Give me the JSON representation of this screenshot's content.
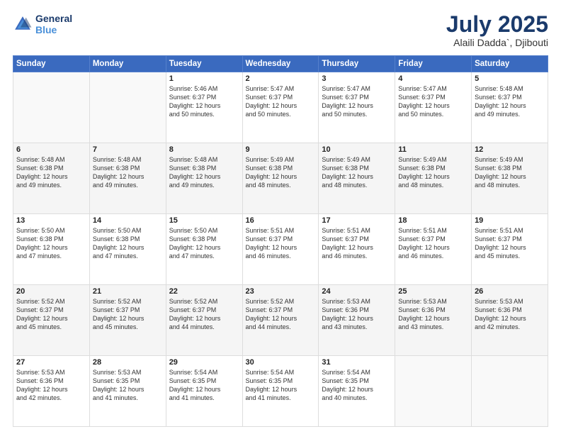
{
  "header": {
    "logo_line1": "General",
    "logo_line2": "Blue",
    "month": "July 2025",
    "location": "Alaili Dadda`, Djibouti"
  },
  "days_of_week": [
    "Sunday",
    "Monday",
    "Tuesday",
    "Wednesday",
    "Thursday",
    "Friday",
    "Saturday"
  ],
  "weeks": [
    [
      {
        "day": "",
        "info": ""
      },
      {
        "day": "",
        "info": ""
      },
      {
        "day": "1",
        "info": "Sunrise: 5:46 AM\nSunset: 6:37 PM\nDaylight: 12 hours\nand 50 minutes."
      },
      {
        "day": "2",
        "info": "Sunrise: 5:47 AM\nSunset: 6:37 PM\nDaylight: 12 hours\nand 50 minutes."
      },
      {
        "day": "3",
        "info": "Sunrise: 5:47 AM\nSunset: 6:37 PM\nDaylight: 12 hours\nand 50 minutes."
      },
      {
        "day": "4",
        "info": "Sunrise: 5:47 AM\nSunset: 6:37 PM\nDaylight: 12 hours\nand 50 minutes."
      },
      {
        "day": "5",
        "info": "Sunrise: 5:48 AM\nSunset: 6:37 PM\nDaylight: 12 hours\nand 49 minutes."
      }
    ],
    [
      {
        "day": "6",
        "info": "Sunrise: 5:48 AM\nSunset: 6:38 PM\nDaylight: 12 hours\nand 49 minutes."
      },
      {
        "day": "7",
        "info": "Sunrise: 5:48 AM\nSunset: 6:38 PM\nDaylight: 12 hours\nand 49 minutes."
      },
      {
        "day": "8",
        "info": "Sunrise: 5:48 AM\nSunset: 6:38 PM\nDaylight: 12 hours\nand 49 minutes."
      },
      {
        "day": "9",
        "info": "Sunrise: 5:49 AM\nSunset: 6:38 PM\nDaylight: 12 hours\nand 48 minutes."
      },
      {
        "day": "10",
        "info": "Sunrise: 5:49 AM\nSunset: 6:38 PM\nDaylight: 12 hours\nand 48 minutes."
      },
      {
        "day": "11",
        "info": "Sunrise: 5:49 AM\nSunset: 6:38 PM\nDaylight: 12 hours\nand 48 minutes."
      },
      {
        "day": "12",
        "info": "Sunrise: 5:49 AM\nSunset: 6:38 PM\nDaylight: 12 hours\nand 48 minutes."
      }
    ],
    [
      {
        "day": "13",
        "info": "Sunrise: 5:50 AM\nSunset: 6:38 PM\nDaylight: 12 hours\nand 47 minutes."
      },
      {
        "day": "14",
        "info": "Sunrise: 5:50 AM\nSunset: 6:38 PM\nDaylight: 12 hours\nand 47 minutes."
      },
      {
        "day": "15",
        "info": "Sunrise: 5:50 AM\nSunset: 6:38 PM\nDaylight: 12 hours\nand 47 minutes."
      },
      {
        "day": "16",
        "info": "Sunrise: 5:51 AM\nSunset: 6:37 PM\nDaylight: 12 hours\nand 46 minutes."
      },
      {
        "day": "17",
        "info": "Sunrise: 5:51 AM\nSunset: 6:37 PM\nDaylight: 12 hours\nand 46 minutes."
      },
      {
        "day": "18",
        "info": "Sunrise: 5:51 AM\nSunset: 6:37 PM\nDaylight: 12 hours\nand 46 minutes."
      },
      {
        "day": "19",
        "info": "Sunrise: 5:51 AM\nSunset: 6:37 PM\nDaylight: 12 hours\nand 45 minutes."
      }
    ],
    [
      {
        "day": "20",
        "info": "Sunrise: 5:52 AM\nSunset: 6:37 PM\nDaylight: 12 hours\nand 45 minutes."
      },
      {
        "day": "21",
        "info": "Sunrise: 5:52 AM\nSunset: 6:37 PM\nDaylight: 12 hours\nand 45 minutes."
      },
      {
        "day": "22",
        "info": "Sunrise: 5:52 AM\nSunset: 6:37 PM\nDaylight: 12 hours\nand 44 minutes."
      },
      {
        "day": "23",
        "info": "Sunrise: 5:52 AM\nSunset: 6:37 PM\nDaylight: 12 hours\nand 44 minutes."
      },
      {
        "day": "24",
        "info": "Sunrise: 5:53 AM\nSunset: 6:36 PM\nDaylight: 12 hours\nand 43 minutes."
      },
      {
        "day": "25",
        "info": "Sunrise: 5:53 AM\nSunset: 6:36 PM\nDaylight: 12 hours\nand 43 minutes."
      },
      {
        "day": "26",
        "info": "Sunrise: 5:53 AM\nSunset: 6:36 PM\nDaylight: 12 hours\nand 42 minutes."
      }
    ],
    [
      {
        "day": "27",
        "info": "Sunrise: 5:53 AM\nSunset: 6:36 PM\nDaylight: 12 hours\nand 42 minutes."
      },
      {
        "day": "28",
        "info": "Sunrise: 5:53 AM\nSunset: 6:35 PM\nDaylight: 12 hours\nand 41 minutes."
      },
      {
        "day": "29",
        "info": "Sunrise: 5:54 AM\nSunset: 6:35 PM\nDaylight: 12 hours\nand 41 minutes."
      },
      {
        "day": "30",
        "info": "Sunrise: 5:54 AM\nSunset: 6:35 PM\nDaylight: 12 hours\nand 41 minutes."
      },
      {
        "day": "31",
        "info": "Sunrise: 5:54 AM\nSunset: 6:35 PM\nDaylight: 12 hours\nand 40 minutes."
      },
      {
        "day": "",
        "info": ""
      },
      {
        "day": "",
        "info": ""
      }
    ]
  ]
}
